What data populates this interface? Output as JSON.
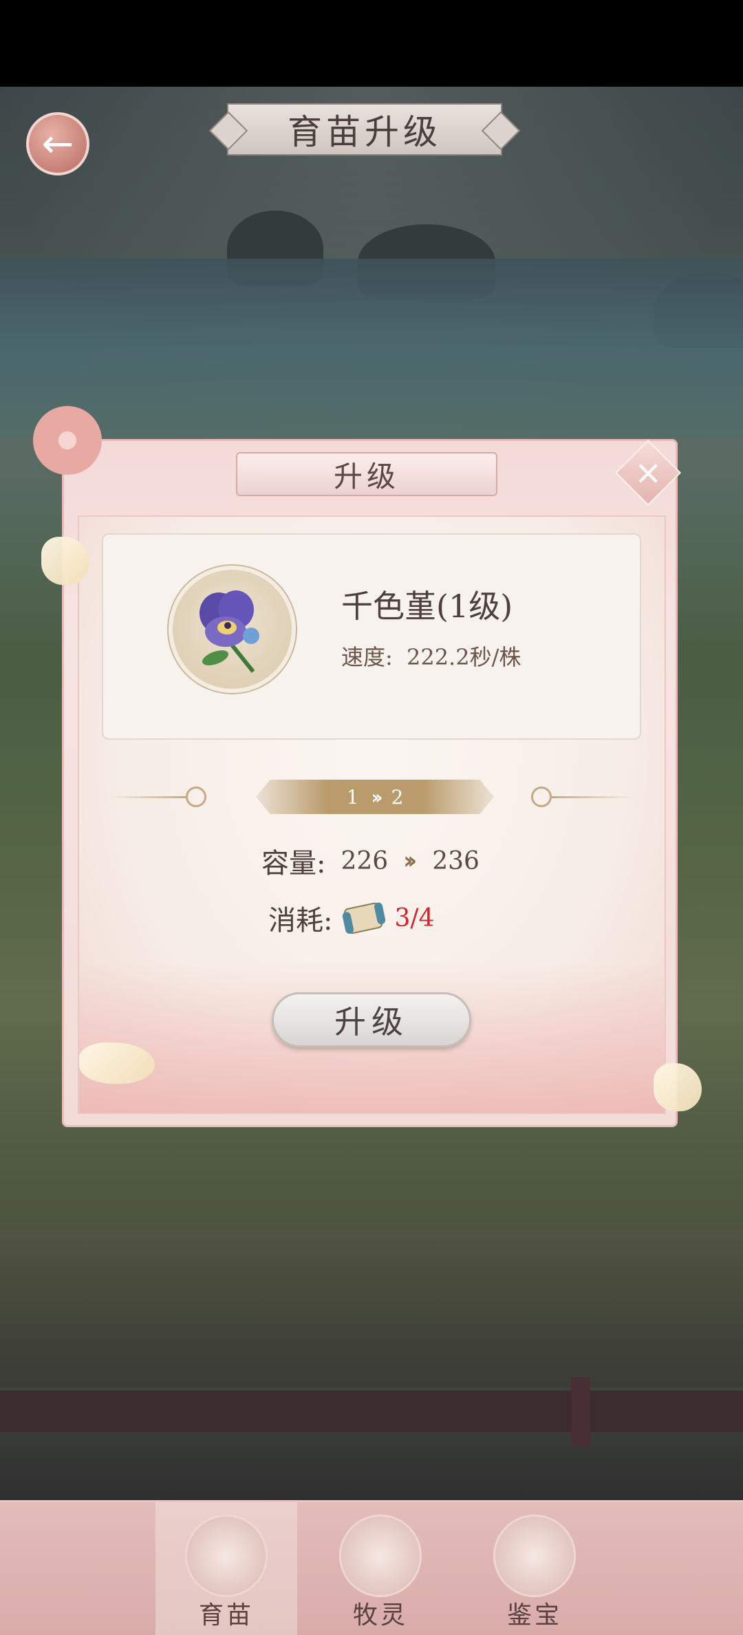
{
  "header": {
    "title": "育苗升级"
  },
  "dialog": {
    "title": "升级",
    "plant": {
      "name": "千色堇(1级)",
      "speed_label": "速度:",
      "speed_value": "222.2秒/株"
    },
    "level": {
      "from": "1",
      "to": "2"
    },
    "capacity": {
      "label": "容量:",
      "from": "226",
      "to": "236"
    },
    "cost": {
      "label": "消耗:",
      "value": "3/4"
    },
    "upgrade_button": "升级"
  },
  "bottom_nav": [
    {
      "label": "育苗",
      "active": true
    },
    {
      "label": "牧灵",
      "active": false
    },
    {
      "label": "鉴宝",
      "active": false
    }
  ],
  "colors": {
    "cost_insufficient": "#d7232a",
    "dialog_pink": "#f4dad8",
    "accent_gold": "#b99b6c"
  }
}
